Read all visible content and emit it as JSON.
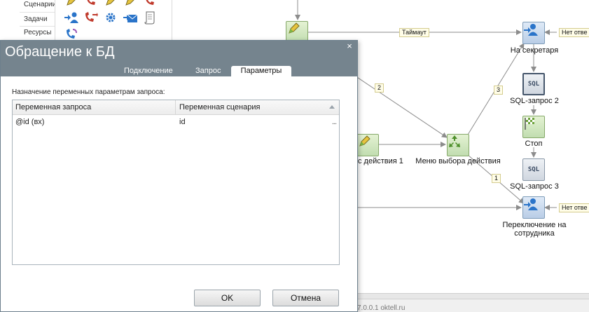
{
  "sidebar": {
    "items": [
      "Сценарии",
      "Задачи",
      "Ресурсы"
    ]
  },
  "palette": {
    "tools": [
      "pencil-icon",
      "phone-icon",
      "edit-icon",
      "phone-icon",
      "user-icon",
      "phone-transfer-icon",
      "gear-icon",
      "mail-icon",
      "scroll-icon",
      "phone-handset-icon"
    ]
  },
  "canvas": {
    "nodes": {
      "secretary": "На секретаря",
      "sql2": "SQL-запрос 2",
      "stop": "Стоп",
      "sql3": "SQL-запрос 3",
      "menu": "Меню выбора действия",
      "action1": "с действия 1",
      "switch_line1": "Переключение на",
      "switch_line2": "сотрудника"
    },
    "edge_labels": {
      "timeout": "Таймаут",
      "no_answer1": "Нет отве",
      "no_answer2": "Нет отве",
      "two": "2",
      "three": "3",
      "one": "1"
    },
    "sql_icon_text": "SQL"
  },
  "statusbar": {
    "text": "7.0.0.1 oktell.ru"
  },
  "dialog": {
    "title": "Обращение к БД",
    "close": "×",
    "tabs": [
      {
        "label": "Подключение",
        "active": false
      },
      {
        "label": "Запрос",
        "active": false
      },
      {
        "label": "Параметры",
        "active": true
      }
    ],
    "section_label": "Назначение переменных параметрам запроса:",
    "grid": {
      "columns": [
        "Переменная запроса",
        "Переменная сценария"
      ],
      "rows": [
        {
          "query_var": "@id  (вх)",
          "script_var": "id",
          "action": "..."
        }
      ]
    },
    "buttons": {
      "ok": "OK",
      "cancel": "Отмена"
    }
  },
  "colors": {
    "header": "#75848e",
    "edge": "#8c8c8c",
    "accent_blue": "#2a74c9"
  }
}
